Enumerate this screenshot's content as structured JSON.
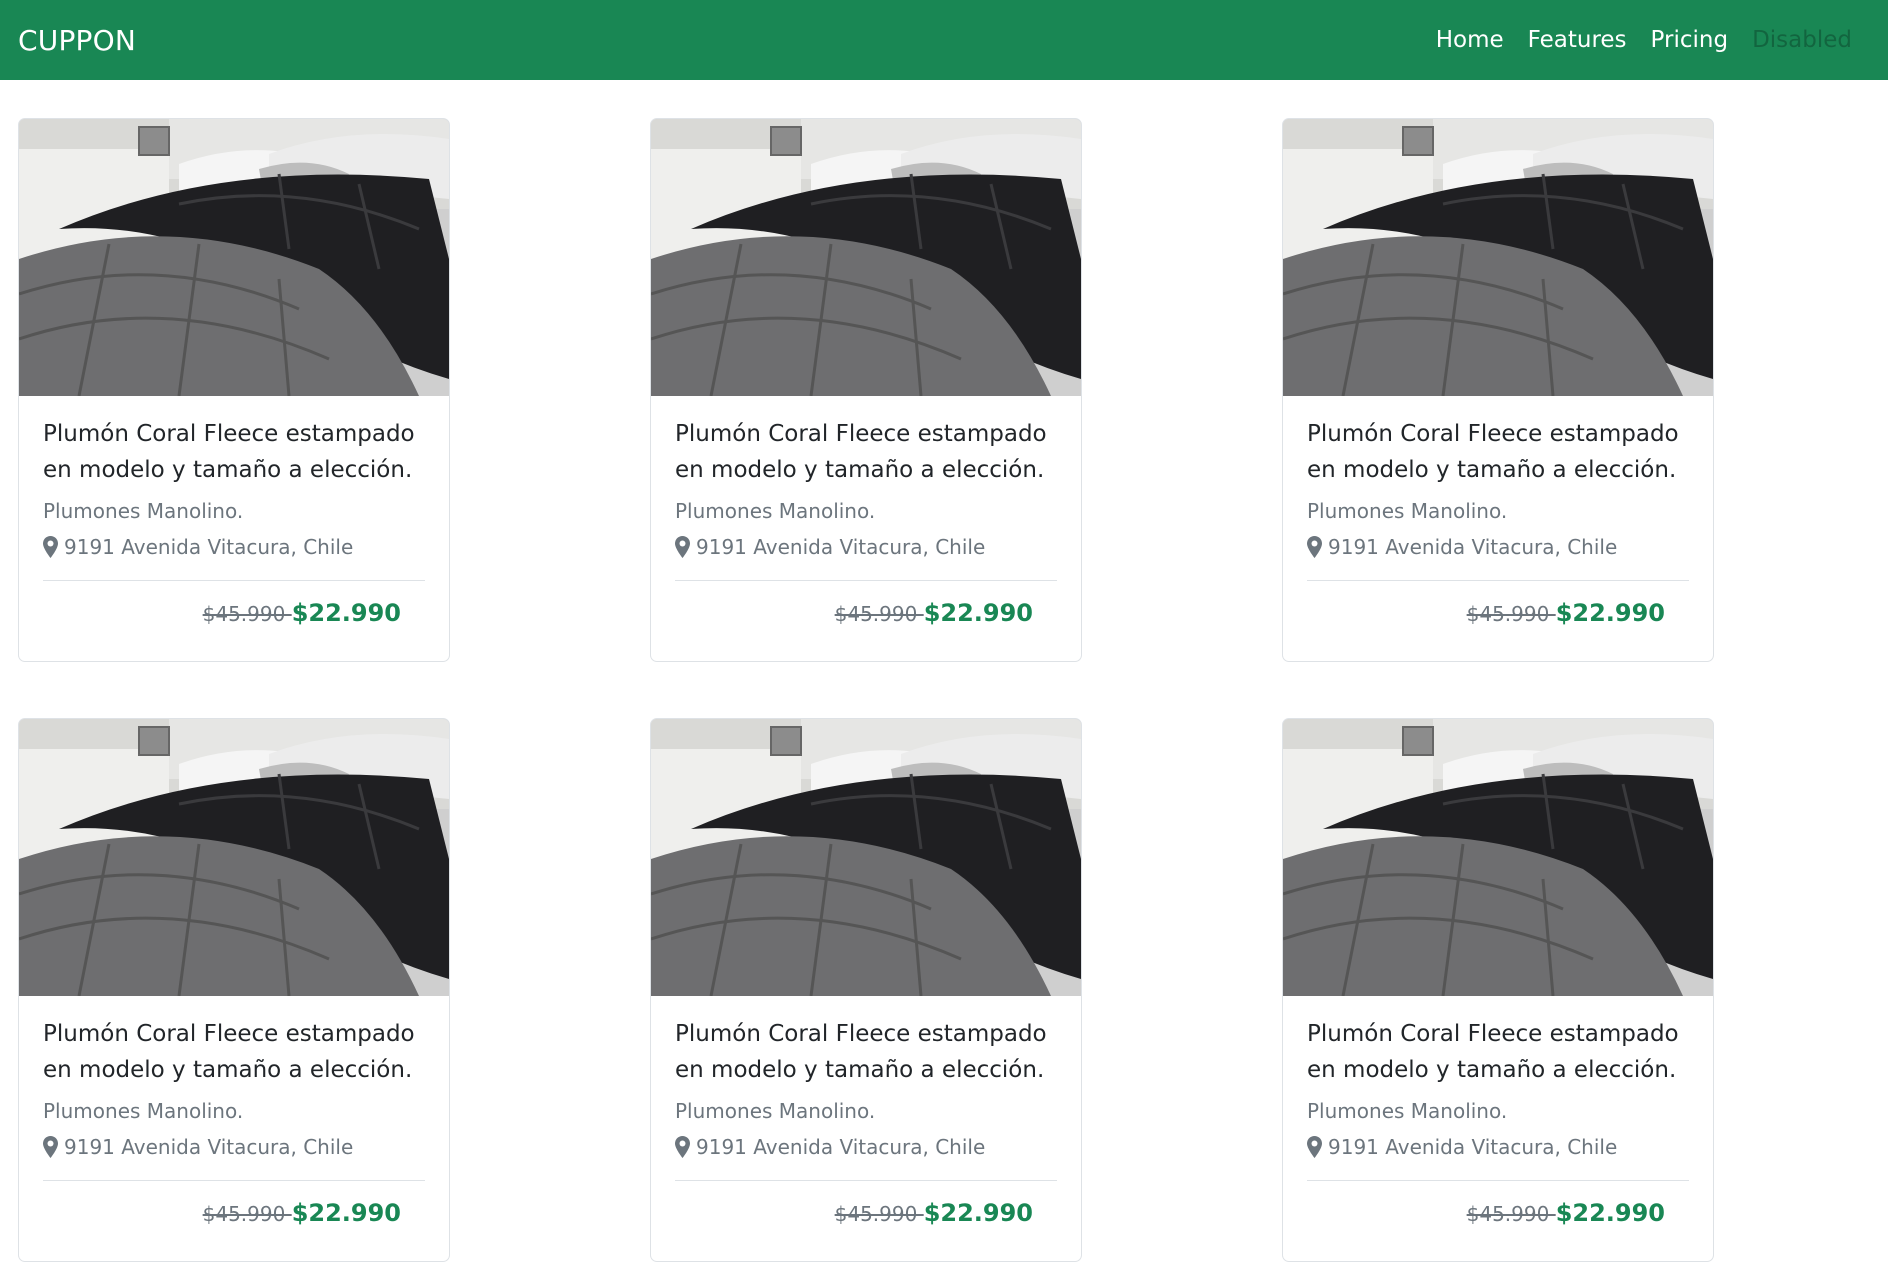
{
  "navbar": {
    "brand": "CUPPON",
    "links": [
      {
        "label": "Home",
        "disabled": false
      },
      {
        "label": "Features",
        "disabled": false
      },
      {
        "label": "Pricing",
        "disabled": false
      },
      {
        "label": "Disabled",
        "disabled": true
      }
    ]
  },
  "colors": {
    "brand": "#198754",
    "muted": "#6c757d"
  },
  "cards": [
    {
      "title": "Plumón Coral Fleece estampado en modelo y tamaño a elección.",
      "seller": "Plumones Manolino.",
      "location": "9191 Avenida Vitacura, Chile",
      "old_price": "$45.990 ",
      "price": "$22.990",
      "icon": "map-marker-icon"
    },
    {
      "title": "Plumón Coral Fleece estampado en modelo y tamaño a elección.",
      "seller": "Plumones Manolino.",
      "location": "9191 Avenida Vitacura, Chile",
      "old_price": "$45.990 ",
      "price": "$22.990",
      "icon": "map-marker-icon"
    },
    {
      "title": "Plumón Coral Fleece estampado en modelo y tamaño a elección.",
      "seller": "Plumones Manolino.",
      "location": "9191 Avenida Vitacura, Chile",
      "old_price": "$45.990 ",
      "price": "$22.990",
      "icon": "map-marker-icon"
    },
    {
      "title": "Plumón Coral Fleece estampado en modelo y tamaño a elección.",
      "seller": "Plumones Manolino.",
      "location": "9191 Avenida Vitacura, Chile",
      "old_price": "$45.990 ",
      "price": "$22.990",
      "icon": "map-marker-icon"
    },
    {
      "title": "Plumón Coral Fleece estampado en modelo y tamaño a elección.",
      "seller": "Plumones Manolino.",
      "location": "9191 Avenida Vitacura, Chile",
      "old_price": "$45.990 ",
      "price": "$22.990",
      "icon": "map-marker-icon"
    },
    {
      "title": "Plumón Coral Fleece estampado en modelo y tamaño a elección.",
      "seller": "Plumones Manolino.",
      "location": "9191 Avenida Vitacura, Chile",
      "old_price": "$45.990 ",
      "price": "$22.990",
      "icon": "map-marker-icon"
    }
  ]
}
